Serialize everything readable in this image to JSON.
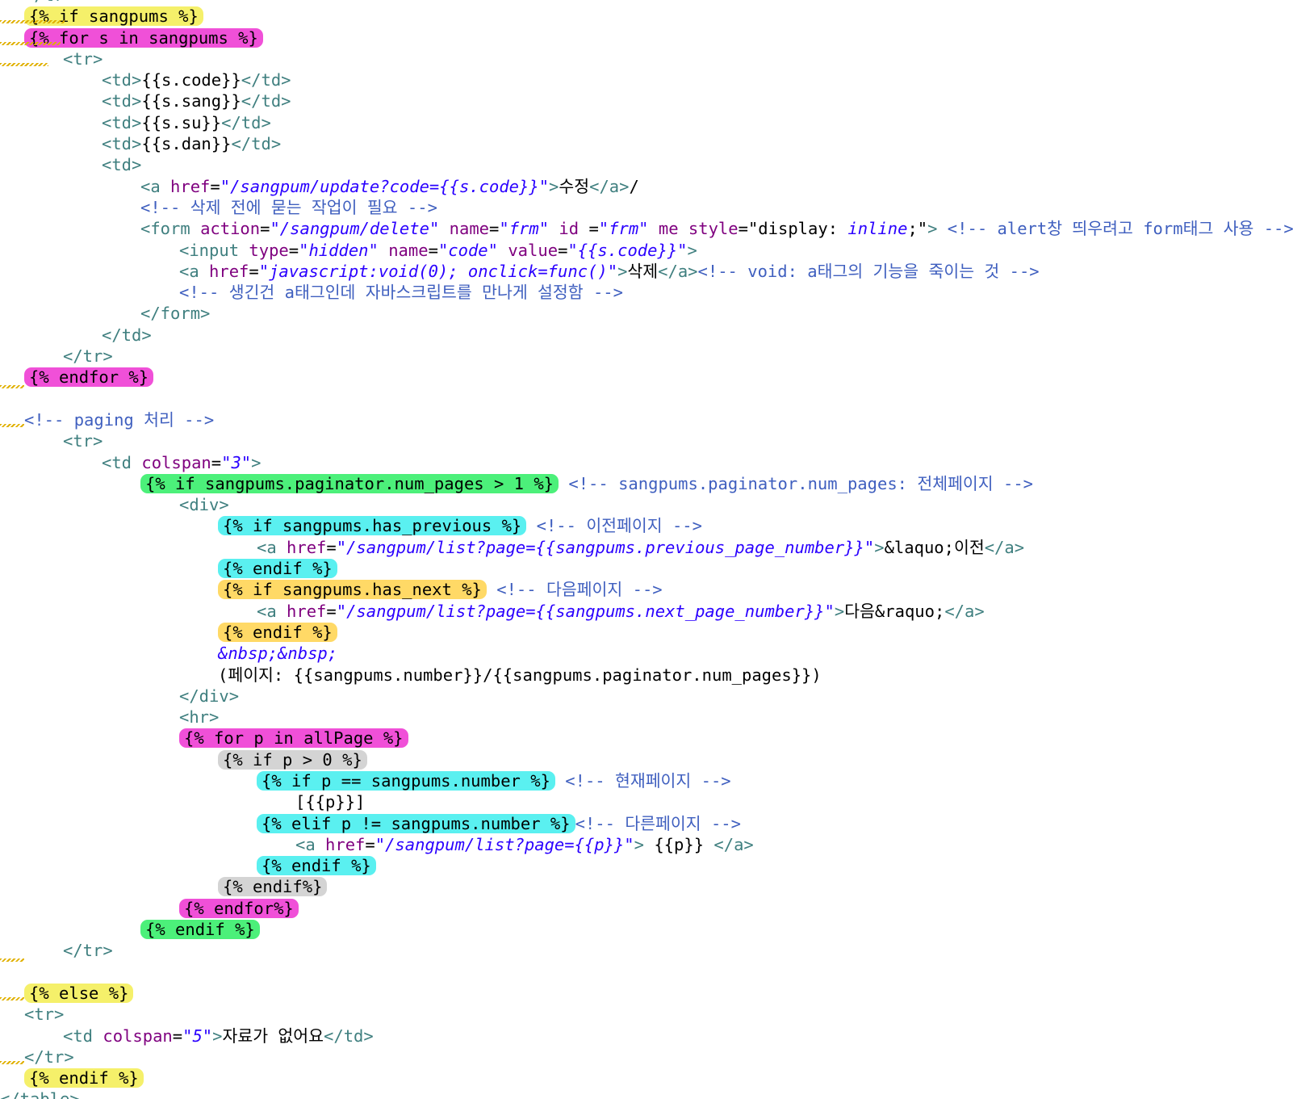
{
  "colors": {
    "tag": "#3f7f7f",
    "attribute": "#7f007f",
    "string": "#2a00ff",
    "comment": "#3f5fbf",
    "text": "#000000",
    "highlight_yellow": "#f5f06a",
    "highlight_magenta": "#f050d8",
    "highlight_green": "#4cf07a",
    "highlight_cyan": "#5af0f0",
    "highlight_orange": "#ffd966",
    "highlight_gray": "#d4d4d4",
    "squiggle": "#e0b000"
  },
  "lines": [
    {
      "indent": 1,
      "segs": [
        {
          "t": "</tr>",
          "k": "tag"
        }
      ]
    },
    {
      "indent": 1,
      "segs": [
        {
          "t": "{% if sangpums %}",
          "k": "tpl",
          "hl": "#f5f06a"
        }
      ]
    },
    {
      "indent": 1,
      "segs": [
        {
          "t": "{% for s in sangpums %}",
          "k": "tpl",
          "hl": "#f050d8"
        }
      ]
    },
    {
      "indent": 2,
      "segs": [
        {
          "t": "<tr>",
          "k": "tag"
        }
      ]
    },
    {
      "indent": 3,
      "segs": [
        {
          "t": "<td>",
          "k": "tag"
        },
        {
          "t": "{{s.code}}",
          "k": "text"
        },
        {
          "t": "</td>",
          "k": "tag"
        }
      ]
    },
    {
      "indent": 3,
      "segs": [
        {
          "t": "<td>",
          "k": "tag"
        },
        {
          "t": "{{s.sang}}",
          "k": "text"
        },
        {
          "t": "</td>",
          "k": "tag"
        }
      ]
    },
    {
      "indent": 3,
      "segs": [
        {
          "t": "<td>",
          "k": "tag"
        },
        {
          "t": "{{s.su}}",
          "k": "text"
        },
        {
          "t": "</td>",
          "k": "tag"
        }
      ]
    },
    {
      "indent": 3,
      "segs": [
        {
          "t": "<td>",
          "k": "tag"
        },
        {
          "t": "{{s.dan}}",
          "k": "text"
        },
        {
          "t": "</td>",
          "k": "tag"
        }
      ]
    },
    {
      "indent": 3,
      "segs": [
        {
          "t": "<td>",
          "k": "tag"
        }
      ]
    },
    {
      "indent": 4,
      "segs": [
        {
          "t": "<a ",
          "k": "tag"
        },
        {
          "t": "href",
          "k": "attr"
        },
        {
          "t": "=",
          "k": "text"
        },
        {
          "t": "\"/sangpum/update?code={{s.code}}\"",
          "k": "str"
        },
        {
          "t": ">",
          "k": "tag"
        },
        {
          "t": "수정",
          "k": "text"
        },
        {
          "t": "</a>",
          "k": "tag"
        },
        {
          "t": "/",
          "k": "text"
        }
      ]
    },
    {
      "indent": 4,
      "segs": [
        {
          "t": "<!-- 삭제 전에 묻는 작업이 필요 -->",
          "k": "cmt"
        }
      ]
    },
    {
      "indent": 4,
      "segs": [
        {
          "t": "<form ",
          "k": "tag"
        },
        {
          "t": "action",
          "k": "attr"
        },
        {
          "t": "=",
          "k": "text"
        },
        {
          "t": "\"/sangpum/delete\"",
          "k": "str"
        },
        {
          "t": " ",
          "k": "text"
        },
        {
          "t": "name",
          "k": "attr"
        },
        {
          "t": "=",
          "k": "text"
        },
        {
          "t": "\"frm\"",
          "k": "str"
        },
        {
          "t": " ",
          "k": "text"
        },
        {
          "t": "id",
          "k": "attr"
        },
        {
          "t": " =",
          "k": "text"
        },
        {
          "t": "\"frm\"",
          "k": "str"
        },
        {
          "t": " ",
          "k": "text"
        },
        {
          "t": "me",
          "k": "attr"
        },
        {
          "t": " ",
          "k": "text"
        },
        {
          "t": "style",
          "k": "attr"
        },
        {
          "t": "=\"display: ",
          "k": "text"
        },
        {
          "t": "inline",
          "k": "str"
        },
        {
          "t": ";\"",
          "k": "text"
        },
        {
          "t": ">",
          "k": "tag"
        },
        {
          "t": " <!-- alert창 띄우려고 form태그 사용 -->",
          "k": "cmt"
        }
      ]
    },
    {
      "indent": 5,
      "segs": [
        {
          "t": "<input ",
          "k": "tag"
        },
        {
          "t": "type",
          "k": "attr"
        },
        {
          "t": "=",
          "k": "text"
        },
        {
          "t": "\"hidden\"",
          "k": "str"
        },
        {
          "t": " ",
          "k": "text"
        },
        {
          "t": "name",
          "k": "attr"
        },
        {
          "t": "=",
          "k": "text"
        },
        {
          "t": "\"code\"",
          "k": "str"
        },
        {
          "t": " ",
          "k": "text"
        },
        {
          "t": "value",
          "k": "attr"
        },
        {
          "t": "=",
          "k": "text"
        },
        {
          "t": "\"{{s.code}}\"",
          "k": "str"
        },
        {
          "t": ">",
          "k": "tag"
        }
      ]
    },
    {
      "indent": 5,
      "segs": [
        {
          "t": "<a ",
          "k": "tag"
        },
        {
          "t": "href",
          "k": "attr"
        },
        {
          "t": "=",
          "k": "text"
        },
        {
          "t": "\"javascript:void(0); onclick=func()\"",
          "k": "str"
        },
        {
          "t": ">",
          "k": "tag"
        },
        {
          "t": "삭제",
          "k": "text"
        },
        {
          "t": "</a>",
          "k": "tag"
        },
        {
          "t": "<!-- void: a태그의 기능을 죽이는 것 -->",
          "k": "cmt"
        }
      ]
    },
    {
      "indent": 5,
      "segs": [
        {
          "t": "<!-- 생긴건 a태그인데 자바스크립트를 만나게 설정함 -->",
          "k": "cmt"
        }
      ]
    },
    {
      "indent": 4,
      "segs": [
        {
          "t": "</form>",
          "k": "tag"
        }
      ]
    },
    {
      "indent": 3,
      "segs": [
        {
          "t": "</td>",
          "k": "tag"
        }
      ]
    },
    {
      "indent": 2,
      "segs": [
        {
          "t": "</tr>",
          "k": "tag"
        }
      ]
    },
    {
      "indent": 1,
      "segs": [
        {
          "t": "{% endfor %}",
          "k": "tpl",
          "hl": "#f050d8"
        }
      ]
    },
    {
      "indent": 0,
      "segs": []
    },
    {
      "indent": 1,
      "segs": [
        {
          "t": "<!-- paging 처리 -->",
          "k": "cmt"
        }
      ]
    },
    {
      "indent": 2,
      "segs": [
        {
          "t": "<tr>",
          "k": "tag"
        }
      ]
    },
    {
      "indent": 3,
      "segs": [
        {
          "t": "<td ",
          "k": "tag"
        },
        {
          "t": "colspan",
          "k": "attr"
        },
        {
          "t": "=",
          "k": "text"
        },
        {
          "t": "\"3\"",
          "k": "str"
        },
        {
          "t": ">",
          "k": "tag"
        }
      ]
    },
    {
      "indent": 4,
      "segs": [
        {
          "t": "{% if sangpums.paginator.num_pages > 1 %}",
          "k": "tpl",
          "hl": "#4cf07a"
        },
        {
          "t": " <!-- sangpums.paginator.num_pages: 전체페이지 -->",
          "k": "cmt"
        }
      ]
    },
    {
      "indent": 5,
      "segs": [
        {
          "t": "<div>",
          "k": "tag"
        }
      ]
    },
    {
      "indent": 6,
      "segs": [
        {
          "t": "{% if sangpums.has_previous %}",
          "k": "tpl",
          "hl": "#5af0f0"
        },
        {
          "t": " <!-- 이전페이지 -->",
          "k": "cmt"
        }
      ]
    },
    {
      "indent": 7,
      "segs": [
        {
          "t": "<a ",
          "k": "tag"
        },
        {
          "t": "href",
          "k": "attr"
        },
        {
          "t": "=",
          "k": "text"
        },
        {
          "t": "\"/sangpum/list?page={{sangpums.previous_page_number}}\"",
          "k": "str"
        },
        {
          "t": ">",
          "k": "tag"
        },
        {
          "t": "&laquo;이전",
          "k": "text"
        },
        {
          "t": "</a>",
          "k": "tag"
        }
      ]
    },
    {
      "indent": 6,
      "segs": [
        {
          "t": "{% endif %}",
          "k": "tpl",
          "hl": "#5af0f0"
        }
      ]
    },
    {
      "indent": 6,
      "segs": [
        {
          "t": "{% if sangpums.has_next %}",
          "k": "tpl",
          "hl": "#ffd966"
        },
        {
          "t": " <!-- 다음페이지 -->",
          "k": "cmt"
        }
      ]
    },
    {
      "indent": 7,
      "segs": [
        {
          "t": "<a ",
          "k": "tag"
        },
        {
          "t": "href",
          "k": "attr"
        },
        {
          "t": "=",
          "k": "text"
        },
        {
          "t": "\"/sangpum/list?page={{sangpums.next_page_number}}\"",
          "k": "str"
        },
        {
          "t": ">",
          "k": "tag"
        },
        {
          "t": "다음&raquo;",
          "k": "text"
        },
        {
          "t": "</a>",
          "k": "tag"
        }
      ]
    },
    {
      "indent": 6,
      "segs": [
        {
          "t": "{% endif %}",
          "k": "tpl",
          "hl": "#ffd966"
        }
      ]
    },
    {
      "indent": 6,
      "segs": [
        {
          "t": "&nbsp;&nbsp;",
          "k": "str"
        }
      ]
    },
    {
      "indent": 6,
      "segs": [
        {
          "t": "(페이지: {{sangpums.number}}/{{sangpums.paginator.num_pages}})",
          "k": "text"
        }
      ]
    },
    {
      "indent": 5,
      "segs": [
        {
          "t": "</div>",
          "k": "tag"
        }
      ]
    },
    {
      "indent": 5,
      "segs": [
        {
          "t": "<hr>",
          "k": "tag"
        }
      ]
    },
    {
      "indent": 5,
      "segs": [
        {
          "t": "{% for p in allPage %}",
          "k": "tpl",
          "hl": "#f050d8"
        }
      ]
    },
    {
      "indent": 6,
      "segs": [
        {
          "t": "{% if p > 0 %}",
          "k": "tpl",
          "hl": "#d4d4d4"
        }
      ]
    },
    {
      "indent": 7,
      "segs": [
        {
          "t": "{% if p == sangpums.number %}",
          "k": "tpl",
          "hl": "#5af0f0"
        },
        {
          "t": " <!-- 현재페이지 -->",
          "k": "cmt"
        }
      ]
    },
    {
      "indent": 8,
      "segs": [
        {
          "t": "[{{p}}]",
          "k": "text"
        }
      ]
    },
    {
      "indent": 7,
      "segs": [
        {
          "t": "{% elif p != sangpums.number %}",
          "k": "tpl",
          "hl": "#5af0f0"
        },
        {
          "t": "<!-- 다른페이지 -->",
          "k": "cmt"
        }
      ]
    },
    {
      "indent": 8,
      "segs": [
        {
          "t": "<a ",
          "k": "tag"
        },
        {
          "t": "href",
          "k": "attr"
        },
        {
          "t": "=",
          "k": "text"
        },
        {
          "t": "\"/sangpum/list?page={{p}}\"",
          "k": "str"
        },
        {
          "t": ">",
          "k": "tag"
        },
        {
          "t": " {{p}} ",
          "k": "text"
        },
        {
          "t": "</a>",
          "k": "tag"
        }
      ]
    },
    {
      "indent": 7,
      "segs": [
        {
          "t": "{% endif %}",
          "k": "tpl",
          "hl": "#5af0f0"
        }
      ]
    },
    {
      "indent": 6,
      "segs": [
        {
          "t": "{% endif%}",
          "k": "tpl",
          "hl": "#d4d4d4"
        }
      ]
    },
    {
      "indent": 5,
      "segs": [
        {
          "t": "{% endfor%}",
          "k": "tpl",
          "hl": "#f050d8"
        }
      ]
    },
    {
      "indent": 4,
      "segs": [
        {
          "t": "{% endif %}",
          "k": "tpl",
          "hl": "#4cf07a"
        }
      ]
    },
    {
      "indent": 2,
      "segs": [
        {
          "t": "</tr>",
          "k": "tag"
        }
      ]
    },
    {
      "indent": 0,
      "segs": []
    },
    {
      "indent": 1,
      "segs": [
        {
          "t": "{% else %}",
          "k": "tpl",
          "hl": "#f5f06a"
        }
      ]
    },
    {
      "indent": 1,
      "segs": [
        {
          "t": "<tr>",
          "k": "tag"
        }
      ]
    },
    {
      "indent": 2,
      "segs": [
        {
          "t": "<td ",
          "k": "tag"
        },
        {
          "t": "colspan",
          "k": "attr"
        },
        {
          "t": "=",
          "k": "text"
        },
        {
          "t": "\"5\"",
          "k": "str"
        },
        {
          "t": ">",
          "k": "tag"
        },
        {
          "t": "자료가 없어요",
          "k": "text"
        },
        {
          "t": "</td>",
          "k": "tag"
        }
      ]
    },
    {
      "indent": 1,
      "segs": [
        {
          "t": "</tr>",
          "k": "tag"
        }
      ]
    },
    {
      "indent": 1,
      "segs": [
        {
          "t": "{% endif %}",
          "k": "tpl",
          "hl": "#f5f06a"
        }
      ]
    },
    {
      "indent": 0,
      "segs": [
        {
          "t": "</table>",
          "k": "tag"
        }
      ]
    }
  ]
}
